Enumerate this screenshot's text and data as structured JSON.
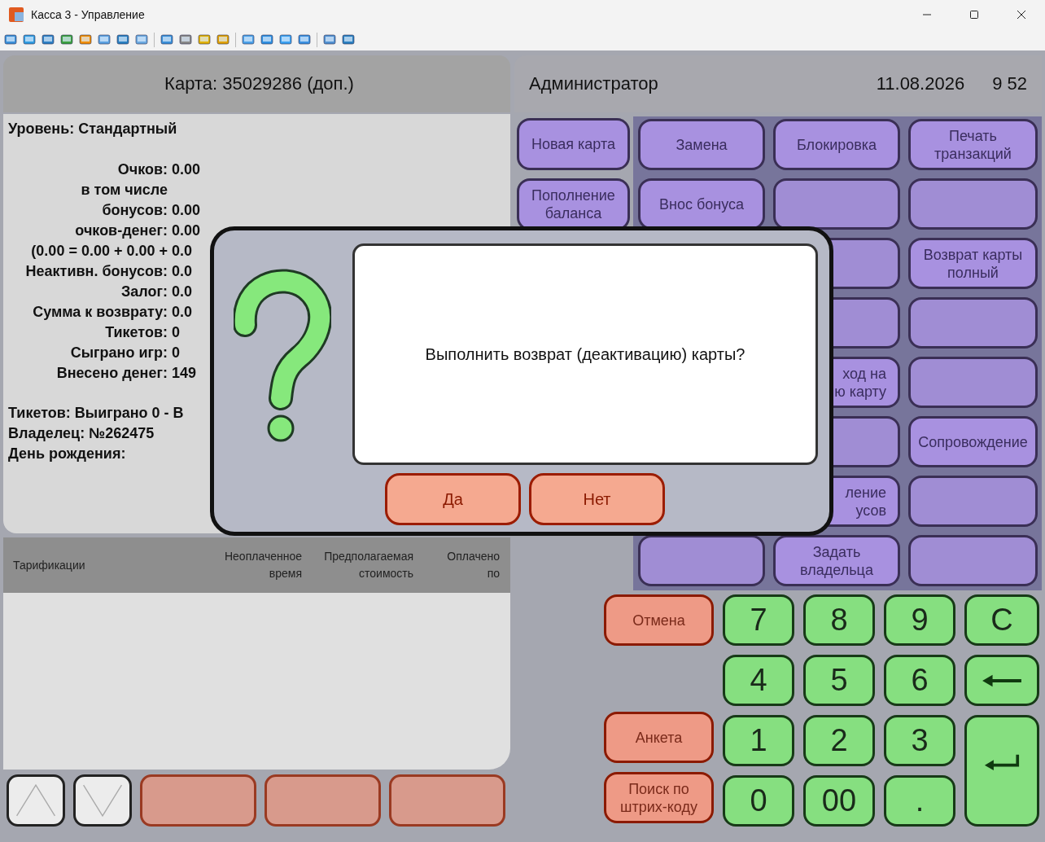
{
  "window": {
    "title": "Касса 3 - Управление"
  },
  "card_header": {
    "title": "Карта: 35029286 (доп.)"
  },
  "card_info": {
    "level": "Уровень: Стандартный",
    "stats": [
      {
        "label": "Очков:",
        "value": "0.00"
      },
      {
        "label": "в том числе"
      },
      {
        "label": "бонусов:",
        "value": "0.00"
      },
      {
        "label": "очков-денег:",
        "value": "0.00"
      },
      {
        "label": "(0.00 = 0.00 + 0.00 +",
        "value": "0.0"
      },
      {
        "label": "Неактивн. бонусов:",
        "value": "0.0"
      },
      {
        "label": "Залог:",
        "value": "0.0"
      },
      {
        "label": "Сумма к возврату:",
        "value": "0.0"
      },
      {
        "label": "Тикетов:",
        "value": "0"
      },
      {
        "label": "Сыграно игр:",
        "value": "0"
      },
      {
        "label": "Внесено денег:",
        "value": "149"
      }
    ],
    "details": [
      "Тикетов: Выиграно 0 - В",
      "Владелец: №262475",
      "День рождения:"
    ]
  },
  "table": {
    "columns": [
      "Тарификации",
      "Неоплаченное время",
      "Предполагаемая стоимость",
      "Оплачено по"
    ]
  },
  "bottom_buttons": [
    {
      "kind": "up"
    },
    {
      "kind": "down"
    },
    {
      "kind": "action",
      "disabled": true
    },
    {
      "kind": "action",
      "disabled": true
    },
    {
      "kind": "action",
      "disabled": true
    }
  ],
  "header": {
    "user": "Администратор",
    "date": "11.08.2026",
    "time": "9 52"
  },
  "side_menu": [
    {
      "label": "Новая карта",
      "disabled": false
    },
    {
      "label": "Пополнение баланса",
      "disabled": false
    }
  ],
  "menu_rows": [
    {
      "cells": [
        {
          "label": "Замена",
          "disabled": false
        },
        {
          "label": "Блокировка",
          "disabled": false
        },
        {
          "label": "Печать транзакций",
          "disabled": false
        }
      ]
    },
    {
      "cells": [
        {
          "label": "Внос бонуса",
          "disabled": false
        },
        {
          "disabled": true
        },
        {
          "disabled": true
        }
      ]
    },
    {
      "cells": [
        {
          "disabled": true
        },
        {
          "label": "Возврат карты полный",
          "disabled": false
        }
      ]
    },
    {
      "cells": [
        {
          "disabled": true
        },
        {
          "disabled": true
        }
      ]
    },
    {
      "cells": [
        {
          "label": "ход на\nю карту",
          "disabled": false
        },
        {
          "disabled": true
        }
      ]
    },
    {
      "cells": [
        {
          "disabled": true
        },
        {
          "label": "Сопровождение",
          "disabled": false
        }
      ]
    },
    {
      "cells": [
        {
          "label": "ление\nусов",
          "disabled": false
        },
        {
          "disabled": true
        }
      ]
    },
    {
      "cells": [
        {
          "disabled": true
        },
        {
          "label": "Задать владельца",
          "disabled": false
        },
        {
          "disabled": true
        }
      ]
    }
  ],
  "side_actions": [
    {
      "label": "Отмена"
    },
    {
      "label": "Анкета"
    },
    {
      "label": "Поиск по штрих-коду"
    }
  ],
  "keypad": [
    {
      "kind": "digit",
      "label": "7"
    },
    {
      "kind": "digit",
      "label": "8"
    },
    {
      "kind": "digit",
      "label": "9"
    },
    {
      "kind": "digit",
      "label": "C"
    },
    {
      "kind": "digit",
      "label": "4"
    },
    {
      "kind": "digit",
      "label": "5"
    },
    {
      "kind": "digit",
      "label": "6"
    },
    {
      "kind": "backspace"
    },
    {
      "kind": "digit",
      "label": "1"
    },
    {
      "kind": "digit",
      "label": "2"
    },
    {
      "kind": "digit",
      "label": "3"
    },
    {
      "kind": "enter"
    },
    {
      "kind": "digit",
      "label": "0"
    },
    {
      "kind": "digit",
      "label": "00"
    },
    {
      "kind": "digit",
      "label": "."
    }
  ],
  "dialog": {
    "message": "Выполнить возврат (деактивацию) карты?",
    "buttons": [
      "Да",
      "Нет"
    ]
  }
}
